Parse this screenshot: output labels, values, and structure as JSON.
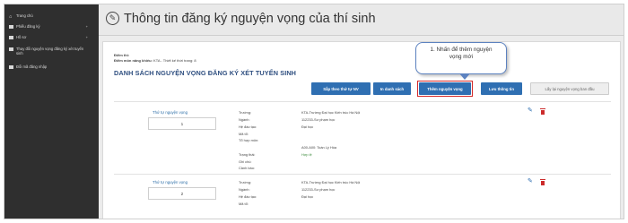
{
  "sidebar": {
    "items": [
      {
        "label": "Trang chủ",
        "icon": "home-icon"
      },
      {
        "label": "Phiếu đăng ký",
        "icon": "document-icon",
        "caret": "+"
      },
      {
        "label": "Hồ sơ",
        "icon": "folder-icon",
        "caret": "+"
      },
      {
        "label": "Thay đổi nguyện vọng đăng ký xét tuyển sinh",
        "icon": "list-icon"
      },
      {
        "label": "Đổi mã đăng nhập",
        "icon": "key-icon"
      }
    ]
  },
  "header": {
    "title": "Thông tin đăng ký nguyện vọng của thí sinh",
    "icon": "edit-circle-icon"
  },
  "meta": {
    "line1": "Điểm thi:",
    "line2_label": "Điểm môn năng khiếu:",
    "line2_value": "KTA - Thiết kế thời trang: 8"
  },
  "list_title": "DANH SÁCH NGUYỆN VỌNG ĐĂNG KÝ XÉT TUYỂN SINH",
  "callout": {
    "line1": "1. Nhấn để thêm nguyện",
    "line2": "vọng mới"
  },
  "toolbar": {
    "sort_label": "Sắp theo thứ tự NV",
    "print_label": "In danh sách",
    "add_label": "Thêm nguyện vọng",
    "save_label": "Lưu thông tin",
    "reset_label": "Lấy lại nguyện vọng ban đầu"
  },
  "records": [
    {
      "order_label": "Thứ tự nguyện vọng",
      "order": "1",
      "fields": [
        {
          "name": "Trường:",
          "value": "KTA-Trường Đại học Kiến trúc Hà Nội"
        },
        {
          "name": "Ngành:",
          "value": "112233-Sư phạm học"
        },
        {
          "name": "Hệ đào tạo:",
          "value": "Đại học"
        },
        {
          "name": "Mã tổ:",
          "value": ""
        },
        {
          "name": "Tổ hợp môn:",
          "value": "A00-A00: Toán Lý Hóa"
        },
        {
          "name": "Trạng thái:",
          "value": "Hợp lệ"
        },
        {
          "name": "Ghi chú:",
          "value": ""
        },
        {
          "name": "Cảnh báo:",
          "value": ""
        }
      ]
    },
    {
      "order_label": "Thứ tự nguyện vọng",
      "order": "2",
      "fields": [
        {
          "name": "Trường:",
          "value": "KTA-Trường Đại học Kiến trúc Hà Nội"
        },
        {
          "name": "Ngành:",
          "value": "112233-Sư phạm học"
        },
        {
          "name": "Hệ đào tạo:",
          "value": "Đại học"
        },
        {
          "name": "Mã tổ:",
          "value": ""
        }
      ]
    }
  ],
  "colors": {
    "accent": "#2f6fb2",
    "title_blue": "#2f4f80",
    "highlight": "#d42a2a",
    "status_green": "#3a8a3a",
    "sidebar_bg": "#2f2f2f"
  }
}
